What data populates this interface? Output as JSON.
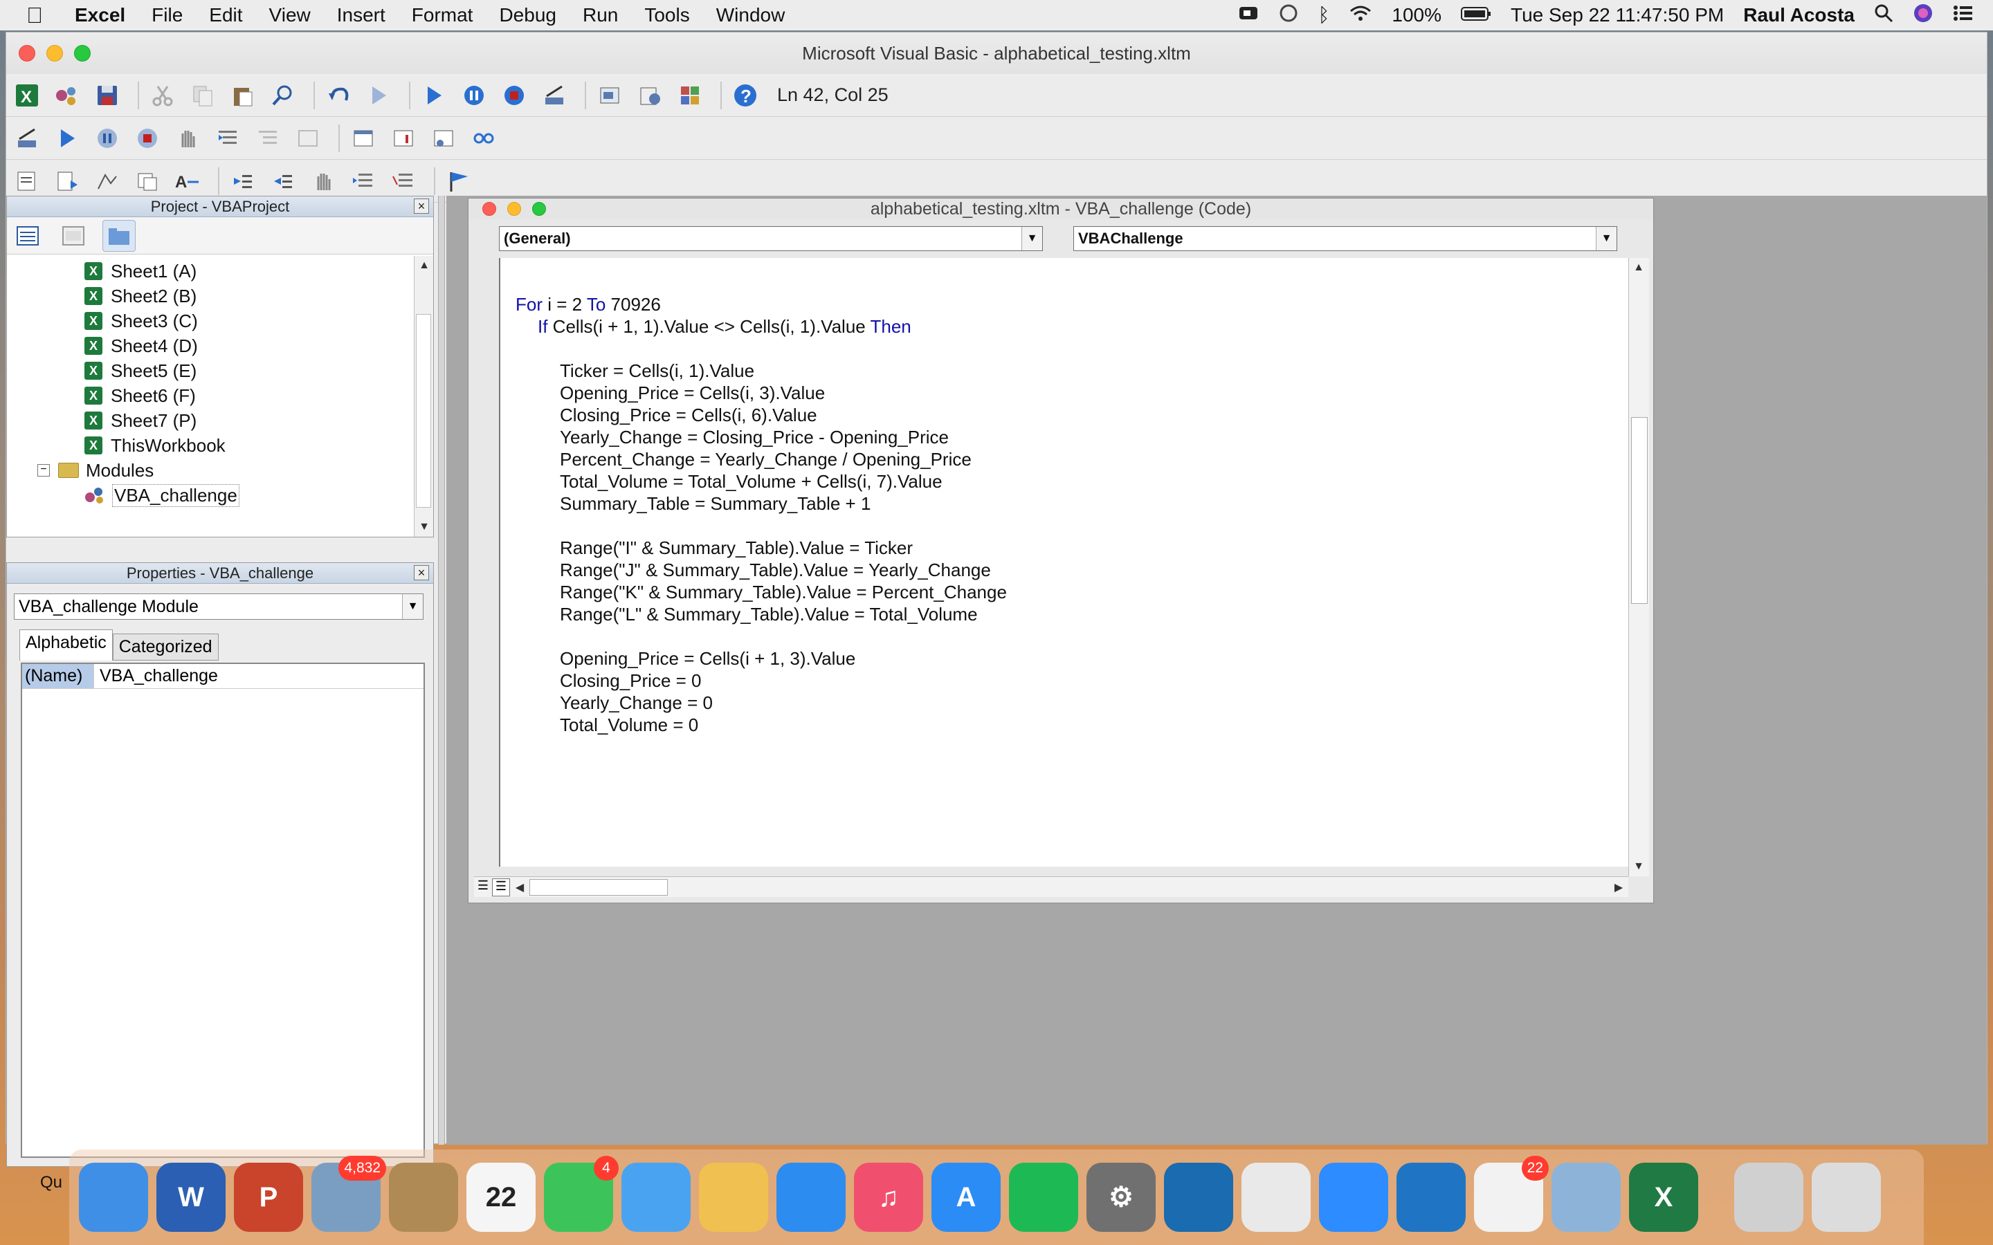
{
  "menubar": {
    "app_name": "Excel",
    "items": [
      "File",
      "Edit",
      "View",
      "Insert",
      "Format",
      "Debug",
      "Run",
      "Tools",
      "Window"
    ],
    "battery": "100%",
    "datetime": "Tue Sep 22  11:47:50 PM",
    "user": "Raul Acosta"
  },
  "window": {
    "title": "Microsoft Visual Basic - alphabetical_testing.xltm",
    "status": "Ln 42, Col 25"
  },
  "project_pane": {
    "title": "Project - VBAProject",
    "items": [
      {
        "label": "Sheet1 (A)"
      },
      {
        "label": "Sheet2 (B)"
      },
      {
        "label": "Sheet3 (C)"
      },
      {
        "label": "Sheet4 (D)"
      },
      {
        "label": "Sheet5 (E)"
      },
      {
        "label": "Sheet6 (F)"
      },
      {
        "label": "Sheet7 (P)"
      },
      {
        "label": "ThisWorkbook"
      }
    ],
    "modules_label": "Modules",
    "module_item": "VBA_challenge"
  },
  "properties_pane": {
    "title": "Properties - VBA_challenge",
    "object_select": "VBA_challenge Module",
    "tabs": [
      "Alphabetic",
      "Categorized"
    ],
    "prop_name": "(Name)",
    "prop_value": "VBA_challenge"
  },
  "code_window": {
    "title": "alphabetical_testing.xltm - VBA_challenge (Code)",
    "object_dropdown": "(General)",
    "procedure_dropdown": "VBAChallenge",
    "lines": [
      {
        "pre": "",
        "kw1": "For",
        "mid": " i = 2 ",
        "kw2": "To",
        "post": " 70926"
      },
      {
        "pre": "",
        "kw1": "If",
        "mid": " Cells(i + 1, 1).Value <> Cells(i, 1).Value ",
        "kw2": "Then",
        "post": ""
      },
      {
        "text": "Ticker = Cells(i, 1).Value"
      },
      {
        "text": "Opening_Price = Cells(i, 3).Value"
      },
      {
        "text": "Closing_Price = Cells(i, 6).Value"
      },
      {
        "text": "Yearly_Change = Closing_Price - Opening_Price"
      },
      {
        "text": "Percent_Change = Yearly_Change / Opening_Price"
      },
      {
        "text": "Total_Volume = Total_Volume + Cells(i, 7).Value"
      },
      {
        "text": "Summary_Table = Summary_Table + 1"
      },
      {
        "text": "Range(\"I\" & Summary_Table).Value = Ticker"
      },
      {
        "text": "Range(\"J\" & Summary_Table).Value = Yearly_Change"
      },
      {
        "text": "Range(\"K\" & Summary_Table).Value = Percent_Change"
      },
      {
        "text": "Range(\"L\" & Summary_Table).Value = Total_Volume"
      },
      {
        "text": "Opening_Price = Cells(i + 1, 3).Value"
      },
      {
        "text": "Closing_Price = 0"
      },
      {
        "text": "Yearly_Change = 0"
      },
      {
        "text": "Total_Volume = 0"
      }
    ]
  },
  "dock": {
    "partial_label": "Qu",
    "apps": [
      {
        "icon": "finder-icon",
        "color": "#3f8fe6",
        "glyph": ""
      },
      {
        "icon": "word-icon",
        "color": "#2b5fb3",
        "glyph": "W"
      },
      {
        "icon": "powerpoint-icon",
        "color": "#c9442a",
        "glyph": "P"
      },
      {
        "icon": "mail-icon",
        "color": "#7a9ec2",
        "glyph": "",
        "badge": "4,832"
      },
      {
        "icon": "contacts-icon",
        "color": "#b08a55",
        "glyph": ""
      },
      {
        "icon": "calendar-icon",
        "color": "#f5f5f5",
        "glyph": "22",
        "dark": true
      },
      {
        "icon": "facetime-icon",
        "color": "#3cc45a",
        "glyph": "",
        "badge": "4"
      },
      {
        "icon": "messages-icon",
        "color": "#4aa3f0",
        "glyph": ""
      },
      {
        "icon": "photos-icon",
        "color": "#f0c050",
        "glyph": ""
      },
      {
        "icon": "safari-icon",
        "color": "#2d8cf0",
        "glyph": ""
      },
      {
        "icon": "music-icon",
        "color": "#f0506e",
        "glyph": "♫"
      },
      {
        "icon": "app-store-icon",
        "color": "#2b8cf5",
        "glyph": "A"
      },
      {
        "icon": "spotify-icon",
        "color": "#1db954",
        "glyph": ""
      },
      {
        "icon": "system-preferences-icon",
        "color": "#707070",
        "glyph": "⚙"
      },
      {
        "icon": "webex-icon",
        "color": "#1a6bb0",
        "glyph": ""
      },
      {
        "icon": "chrome-icon",
        "color": "#e9e9e9",
        "glyph": ""
      },
      {
        "icon": "zoom-icon",
        "color": "#2d8cff",
        "glyph": ""
      },
      {
        "icon": "vscode-icon",
        "color": "#1f75c4",
        "glyph": ""
      },
      {
        "icon": "slack-icon",
        "color": "#f2f2f2",
        "glyph": "",
        "badge": "22"
      },
      {
        "icon": "preview-icon",
        "color": "#8db4d8",
        "glyph": ""
      },
      {
        "icon": "excel-icon",
        "color": "#1f7a43",
        "glyph": "X"
      },
      {
        "icon": "screenshot-icon",
        "color": "#d0d0d0",
        "glyph": ""
      },
      {
        "icon": "trash-icon",
        "color": "#dcdcdc",
        "glyph": ""
      }
    ]
  }
}
